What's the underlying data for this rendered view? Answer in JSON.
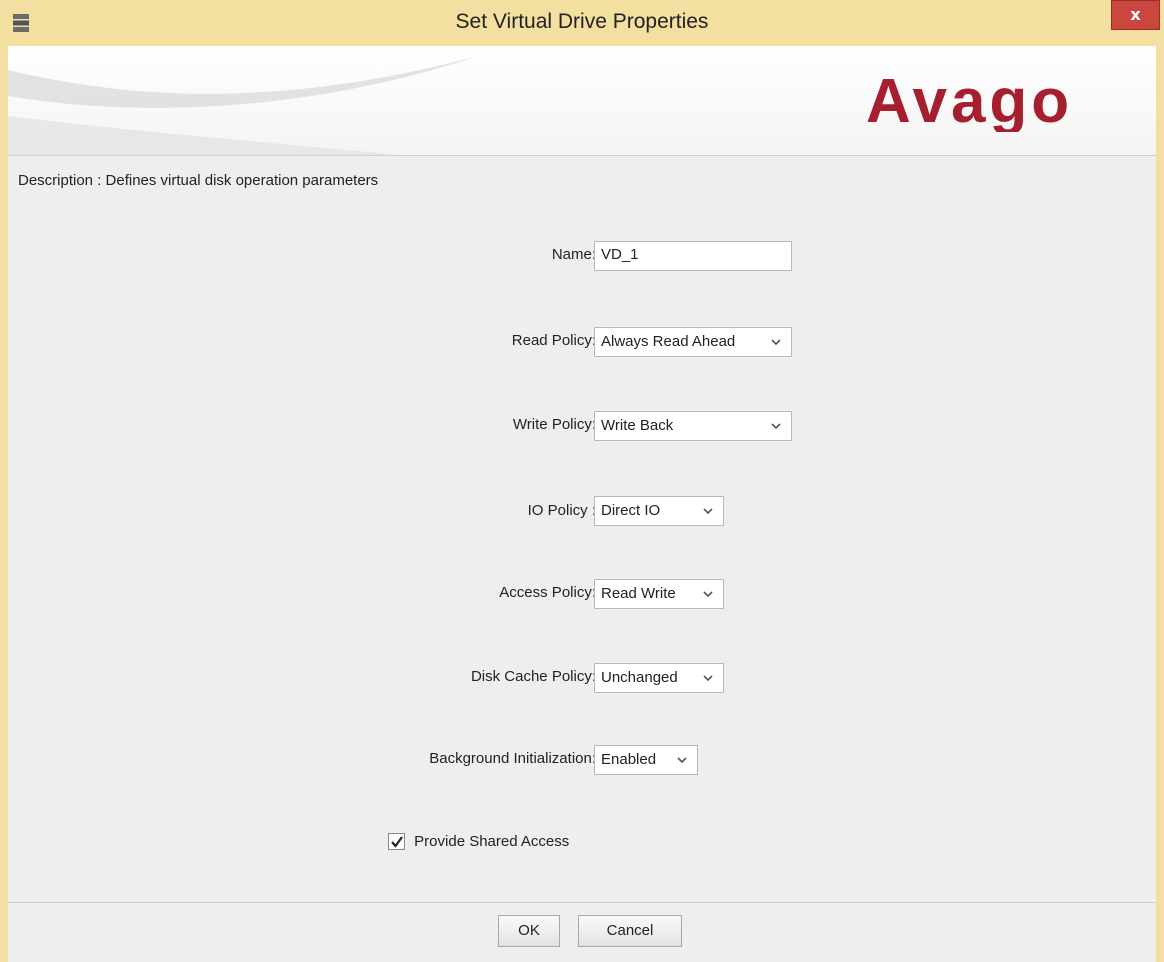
{
  "window": {
    "title": "Set Virtual Drive Properties",
    "close_label": "x",
    "brand": "Avago",
    "brand_color": "#a51f2e",
    "titlebar_color": "#f3df9f"
  },
  "description": "Description : Defines virtual disk operation parameters",
  "form": {
    "name": {
      "label": "Name:",
      "value": "VD_1"
    },
    "read_policy": {
      "label": "Read Policy:",
      "value": "Always Read Ahead"
    },
    "write_policy": {
      "label": "Write Policy:",
      "value": "Write Back"
    },
    "io_policy": {
      "label": "IO Policy :",
      "value": "Direct IO"
    },
    "access_policy": {
      "label": "Access Policy:",
      "value": "Read Write"
    },
    "disk_cache_policy": {
      "label": "Disk Cache Policy:",
      "value": "Unchanged"
    },
    "background_init": {
      "label": "Background Initialization:",
      "value": "Enabled"
    },
    "shared_access": {
      "label": "Provide Shared Access",
      "checked": true
    }
  },
  "buttons": {
    "ok": "OK",
    "cancel": "Cancel"
  }
}
